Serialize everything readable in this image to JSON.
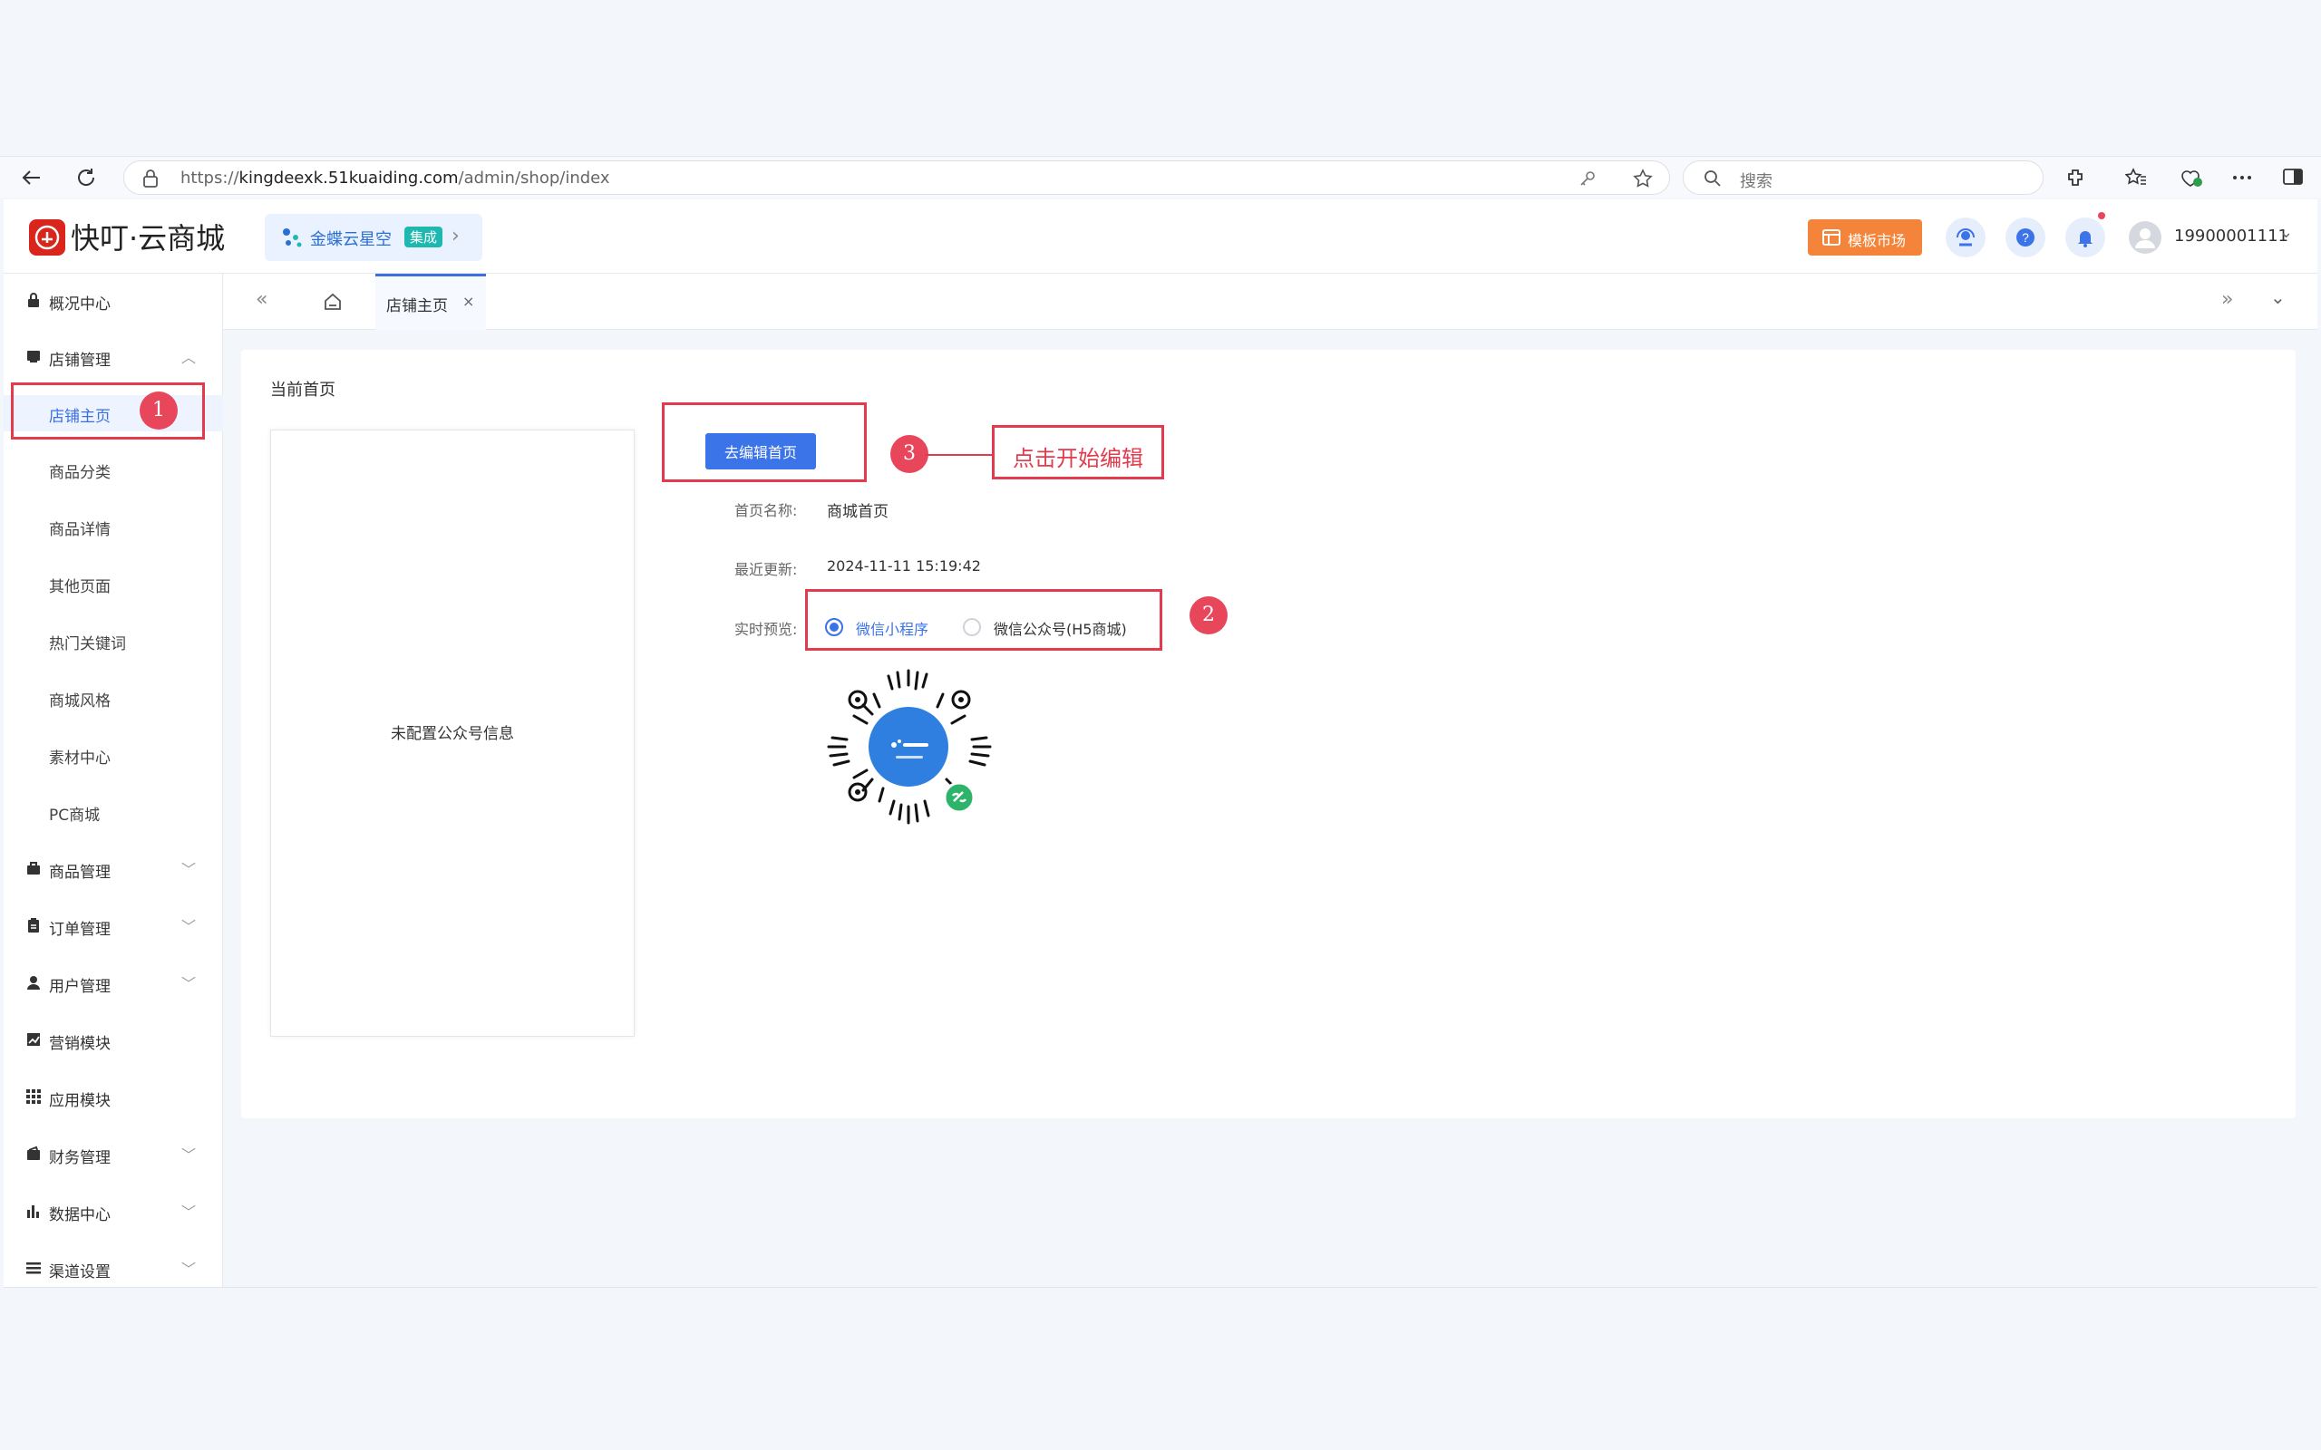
{
  "browser": {
    "url_prefix": "https://",
    "url_host": "kingdeexk.51kuaiding.com",
    "url_path": "/admin/shop/index",
    "search_placeholder": "搜索"
  },
  "header": {
    "app_title": "快叮·云商城",
    "integration_name": "金蝶云星空",
    "integration_tag": "集成",
    "template_market": "模板市场",
    "user_phone": "19900001111"
  },
  "sidebar": {
    "items": [
      {
        "label": "概况中心",
        "icon": "lock-icon"
      },
      {
        "label": "店铺管理",
        "icon": "shop-icon",
        "expanded": true
      },
      {
        "label": "店铺主页",
        "sub": true,
        "active": true
      },
      {
        "label": "商品分类",
        "sub": true
      },
      {
        "label": "商品详情",
        "sub": true
      },
      {
        "label": "其他页面",
        "sub": true
      },
      {
        "label": "热门关键词",
        "sub": true
      },
      {
        "label": "商城风格",
        "sub": true
      },
      {
        "label": "素材中心",
        "sub": true
      },
      {
        "label": "PC商城",
        "sub": true
      },
      {
        "label": "商品管理",
        "icon": "briefcase-icon"
      },
      {
        "label": "订单管理",
        "icon": "clipboard-icon"
      },
      {
        "label": "用户管理",
        "icon": "user-icon"
      },
      {
        "label": "营销模块",
        "icon": "chart-line-icon"
      },
      {
        "label": "应用模块",
        "icon": "grid-icon"
      },
      {
        "label": "财务管理",
        "icon": "wallet-icon"
      },
      {
        "label": "数据中心",
        "icon": "bar-chart-icon"
      },
      {
        "label": "渠道设置",
        "icon": "list-icon"
      }
    ]
  },
  "tabs": {
    "active_label": "店铺主页",
    "close": "×"
  },
  "main": {
    "current_home_label": "当前首页",
    "preview_empty_msg": "未配置公众号信息",
    "edit_button": "去编辑首页",
    "home_name_label": "首页名称:",
    "home_name_value": "商城首页",
    "last_update_label": "最近更新:",
    "last_update_value": "2024-11-11 15:19:42",
    "live_preview_label": "实时预览:",
    "preview_options": [
      "微信小程序",
      "微信公众号(H5商城)"
    ],
    "preview_selected": "微信小程序"
  },
  "annotations": {
    "num1": "1",
    "num2": "2",
    "num3": "3",
    "callout": "点击开始编辑"
  },
  "colors": {
    "accent": "#3b73e8",
    "annotation": "#e23b4e",
    "brand": "#d9251c",
    "template_btn": "#f5843b"
  }
}
